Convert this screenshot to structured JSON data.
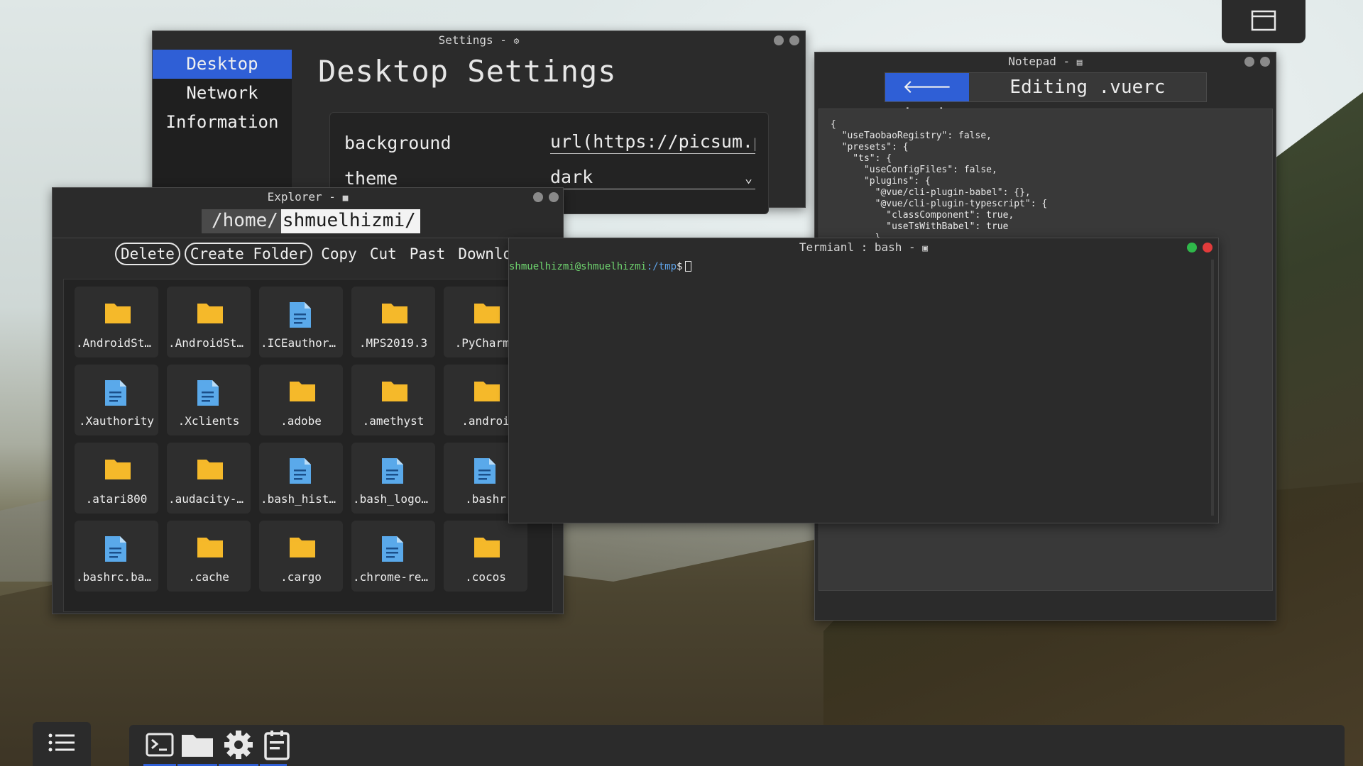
{
  "settings": {
    "title": "Settings - ",
    "icon": "gear-icon",
    "sidebar": [
      "Desktop",
      "Network",
      "Information"
    ],
    "heading": "Desktop Settings",
    "rows": [
      {
        "label": "background",
        "value": "url(https://picsum.ph"
      },
      {
        "label": "theme",
        "value": "dark"
      }
    ]
  },
  "notepad": {
    "title": "Notepad - ",
    "icon": "notepad-icon",
    "back_label": "🡐 back",
    "editing_label": "Editing .vuerc",
    "content": "{\n  \"useTaobaoRegistry\": false,\n  \"presets\": {\n    \"ts\": {\n      \"useConfigFiles\": false,\n      \"plugins\": {\n        \"@vue/cli-plugin-babel\": {},\n        \"@vue/cli-plugin-typescript\": {\n          \"classComponent\": true,\n          \"useTsWithBabel\": true\n        }"
  },
  "explorer": {
    "title": "Explorer - ",
    "icon": "folder-icon",
    "path_prefix": "/home/",
    "path_user": "shmuelhizmi/",
    "toolbar": [
      "Delete",
      "Create Folder",
      "Copy",
      "Cut",
      "Past",
      "Download"
    ],
    "files": [
      {
        "name": ".AndroidStu…",
        "type": "folder"
      },
      {
        "name": ".AndroidStu…",
        "type": "folder"
      },
      {
        "name": ".ICEauthori…",
        "type": "file"
      },
      {
        "name": ".MPS2019.3",
        "type": "folder"
      },
      {
        "name": ".PyCharmC",
        "type": "folder"
      },
      {
        "name": ".Xauthority",
        "type": "file"
      },
      {
        "name": ".Xclients",
        "type": "file"
      },
      {
        "name": ".adobe",
        "type": "folder"
      },
      {
        "name": ".amethyst",
        "type": "folder"
      },
      {
        "name": ".androi",
        "type": "folder"
      },
      {
        "name": ".atari800",
        "type": "folder"
      },
      {
        "name": ".audacity-d…",
        "type": "folder"
      },
      {
        "name": ".bash_histo…",
        "type": "file"
      },
      {
        "name": ".bash_logout",
        "type": "file"
      },
      {
        "name": ".bashr",
        "type": "file"
      },
      {
        "name": ".bashrc.bac…",
        "type": "file"
      },
      {
        "name": ".cache",
        "type": "folder"
      },
      {
        "name": ".cargo",
        "type": "folder"
      },
      {
        "name": ".chrome-rem…",
        "type": "file"
      },
      {
        "name": ".cocos",
        "type": "folder"
      }
    ]
  },
  "terminal": {
    "title": "Termianl : bash - ",
    "icon": "terminal-icon",
    "prompt_user": "shmuelhizmi@shmuelhizmi",
    "prompt_path": ":/tmp",
    "prompt_symbol": "$"
  },
  "taskbar": {
    "start_icon": "menu-list-icon",
    "apps": [
      "terminal-icon",
      "folder-icon",
      "gear-icon",
      "notepad-icon"
    ]
  },
  "colors": {
    "accent": "#2f5fd6",
    "folder": "#f5b82a",
    "file": "#5aa9ea",
    "window_bg": "#2b2b2b",
    "prompt_user": "#6fd46f",
    "prompt_path": "#5fa3e8"
  }
}
